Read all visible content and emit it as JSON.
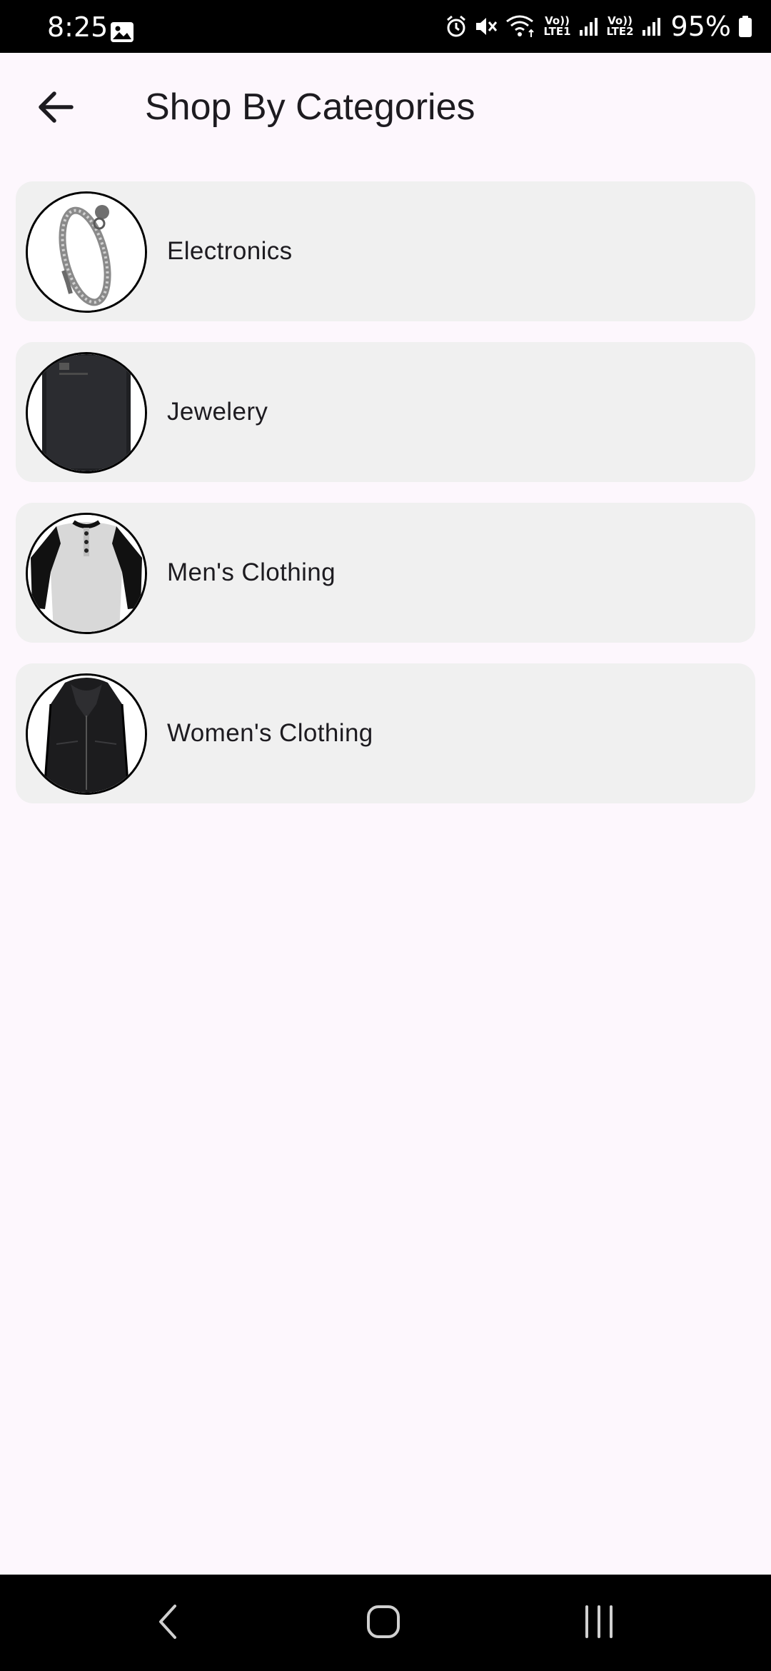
{
  "status_bar": {
    "time": "8:25",
    "battery_percent": "95%",
    "sim1_label": "LTE1",
    "sim2_label": "LTE2",
    "icons": [
      "gallery-icon",
      "alarm-icon",
      "mute-icon",
      "wifi-icon",
      "signal-icon",
      "signal-icon",
      "battery-icon"
    ]
  },
  "app_bar": {
    "title": "Shop By Categories",
    "back_icon": "arrow-left-icon"
  },
  "categories": [
    {
      "label": "Electronics",
      "image": "bracelet-image"
    },
    {
      "label": "Jewelery",
      "image": "hard-drive-image"
    },
    {
      "label": "Men's Clothing",
      "image": "raglan-shirt-image"
    },
    {
      "label": "Women's Clothing",
      "image": "leather-jacket-image"
    }
  ],
  "nav_bar": {
    "icons": [
      "back-nav-icon",
      "home-nav-icon",
      "recents-nav-icon"
    ]
  },
  "colors": {
    "background": "#fdf7fd",
    "card": "#f0f0f0",
    "text": "#1d1b20",
    "bars": "#000000"
  }
}
